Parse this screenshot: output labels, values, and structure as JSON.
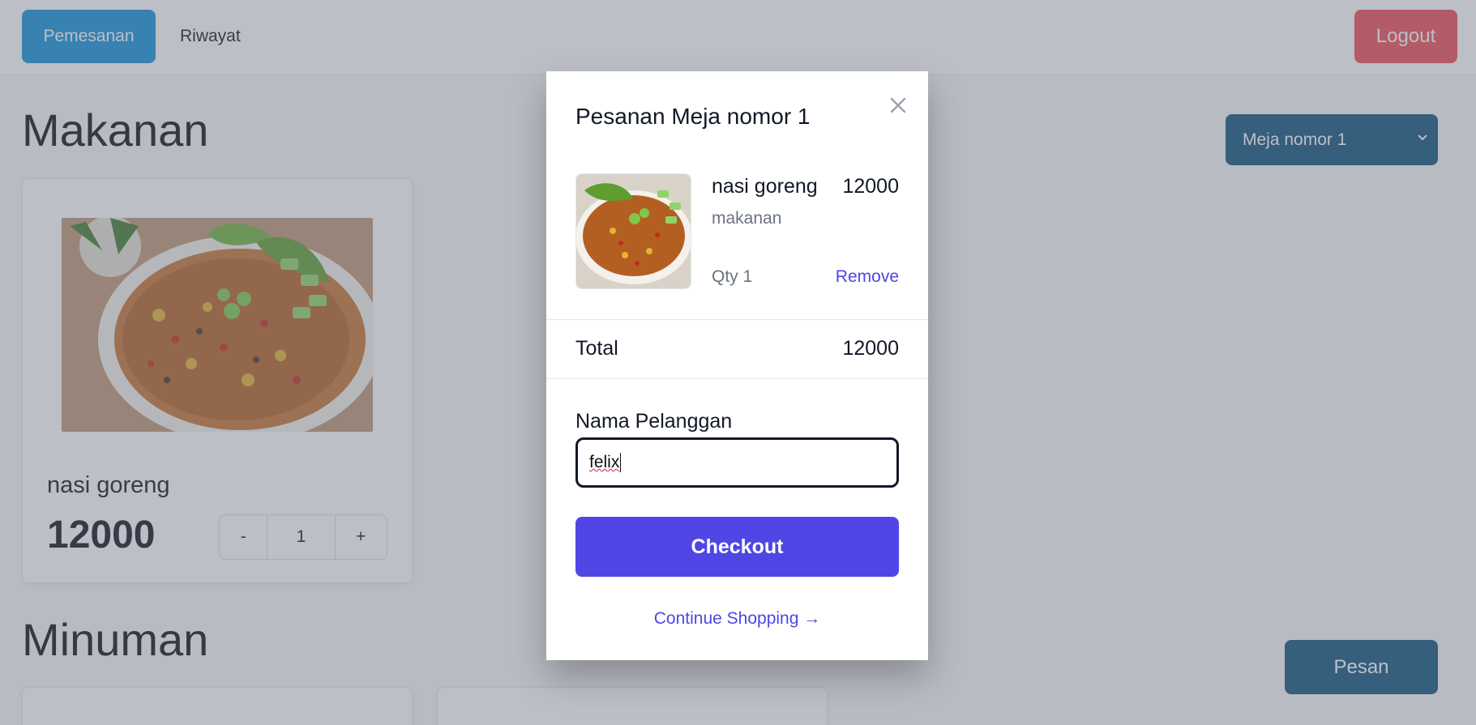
{
  "nav": {
    "orders_tab": "Pemesanan",
    "history_tab": "Riwayat",
    "logout": "Logout"
  },
  "sections": {
    "food_title": "Makanan",
    "drinks_title": "Minuman"
  },
  "food_items": [
    {
      "name": "nasi goreng",
      "price": "12000",
      "quantity": "1",
      "minus": "-",
      "plus": "+"
    }
  ],
  "table_select": {
    "selected": "Meja nomor 1"
  },
  "order_button": "Pesan",
  "modal": {
    "title": "Pesanan Meja nomor 1",
    "item": {
      "name": "nasi goreng",
      "price": "12000",
      "category": "makanan",
      "quantity": "Qty 1",
      "remove": "Remove"
    },
    "total_label": "Total",
    "total_value": "12000",
    "customer_label": "Nama Pelanggan",
    "customer_value": "felix",
    "checkout": "Checkout",
    "continue": "Continue Shopping →"
  },
  "colors": {
    "nav_active": "#0d90d8",
    "logout": "#ef4a52",
    "select_bg": "#0b4f7a",
    "checkout": "#4f46e5",
    "overlay": "rgba(107,114,128,0.45)"
  }
}
